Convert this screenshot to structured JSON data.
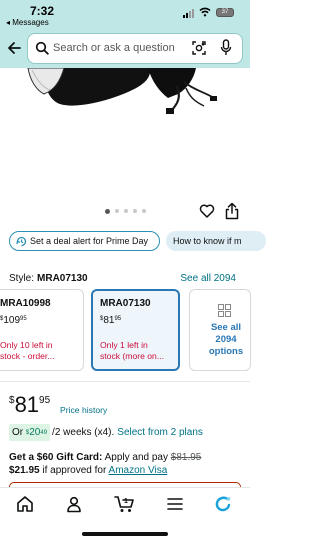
{
  "status_bar": {
    "time": "7:32",
    "back_app": "◂ Messages",
    "battery": "37"
  },
  "search": {
    "placeholder": "Search or ask a question",
    "back_icon": "back-arrow-icon",
    "search_icon": "magnifier-icon",
    "camera_icon": "camera-lens-icon",
    "mic_icon": "microphone-icon"
  },
  "gallery": {
    "dot_count": 5,
    "active_dot": 0
  },
  "deal_chips": {
    "deal_alert": "Set a deal alert for Prime Day",
    "how_to": "How to know if m"
  },
  "style": {
    "label": "Style:",
    "value": "MRA07130",
    "see_all": "See all 2094"
  },
  "variants": [
    {
      "sku": "MRA10998",
      "price_symbol": "$",
      "price_whole": "109",
      "price_fraction": "95",
      "stock_line1": "Only 10 left in",
      "stock_line2": "stock - order..."
    },
    {
      "sku": "MRA07130",
      "price_symbol": "$",
      "price_whole": "81",
      "price_fraction": "95",
      "stock_line1": "Only 1 left in",
      "stock_line2": "stock (more on..."
    }
  ],
  "more_options": {
    "line1": "See all",
    "line2": "2094",
    "line3": "options"
  },
  "price": {
    "symbol": "$",
    "whole": "81",
    "fraction": "95",
    "history_link": "Price history"
  },
  "installments": {
    "prefix": "Or",
    "symbol": "$",
    "whole": "20",
    "fraction": "49",
    "term": "/2 weeks (x4).",
    "plans_link": "Select from 2 plans"
  },
  "gift_card": {
    "headline": "Get a $60 Gift Card:",
    "text": "Apply and pay",
    "old_price": "$81.95",
    "new_price": "$21.95",
    "condition": "if approved for",
    "card_link": "Amazon Visa"
  },
  "tabs": [
    {
      "icon": "home-icon"
    },
    {
      "icon": "account-icon"
    },
    {
      "icon": "cart-icon",
      "badge": "1"
    },
    {
      "icon": "menu-icon"
    },
    {
      "icon": "rufus-icon"
    }
  ],
  "colors": {
    "header_bg": "#bfe7e6",
    "link": "#007185",
    "deal_red": "#CC0C39",
    "selected_border": "#2a77b6"
  }
}
